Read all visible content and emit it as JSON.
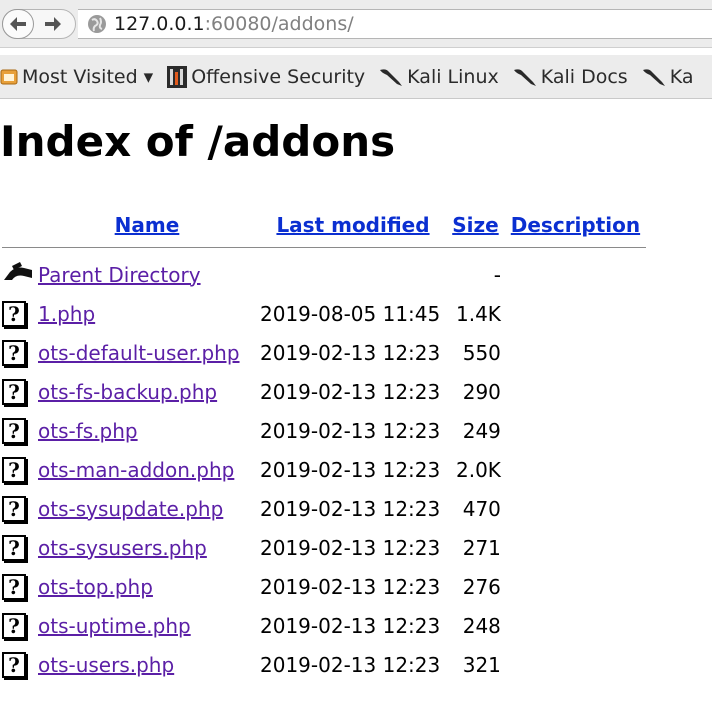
{
  "browser": {
    "url_host": "127.0.0.1",
    "url_rest": ":60080/addons/",
    "bookmarks": [
      {
        "label": "Most Visited ▾",
        "icon": "most-visited-icon"
      },
      {
        "label": "Offensive Security",
        "icon": "offensive-security-icon"
      },
      {
        "label": "Kali Linux",
        "icon": "kali-dragon-icon"
      },
      {
        "label": "Kali Docs",
        "icon": "kali-dragon-icon"
      },
      {
        "label": "Ka",
        "icon": "kali-dragon-icon"
      }
    ]
  },
  "page": {
    "title": "Index of /addons",
    "columns": {
      "name": "Name",
      "last_modified": "Last modified",
      "size": "Size",
      "description": "Description"
    },
    "parent": {
      "name": "Parent Directory",
      "size": "-"
    },
    "files": [
      {
        "name": "1.php",
        "modified": "2019-08-05 11:45",
        "size": "1.4K"
      },
      {
        "name": "ots-default-user.php",
        "modified": "2019-02-13 12:23",
        "size": "550"
      },
      {
        "name": "ots-fs-backup.php",
        "modified": "2019-02-13 12:23",
        "size": "290"
      },
      {
        "name": "ots-fs.php",
        "modified": "2019-02-13 12:23",
        "size": "249"
      },
      {
        "name": "ots-man-addon.php",
        "modified": "2019-02-13 12:23",
        "size": "2.0K"
      },
      {
        "name": "ots-sysupdate.php",
        "modified": "2019-02-13 12:23",
        "size": "470"
      },
      {
        "name": "ots-sysusers.php",
        "modified": "2019-02-13 12:23",
        "size": "271"
      },
      {
        "name": "ots-top.php",
        "modified": "2019-02-13 12:23",
        "size": "276"
      },
      {
        "name": "ots-uptime.php",
        "modified": "2019-02-13 12:23",
        "size": "248"
      },
      {
        "name": "ots-users.php",
        "modified": "2019-02-13 12:23",
        "size": "321"
      }
    ]
  },
  "colors": {
    "visited_link": "#5b1fa6",
    "header_link": "#0b2fd1",
    "chrome_bg": "#ececec"
  }
}
